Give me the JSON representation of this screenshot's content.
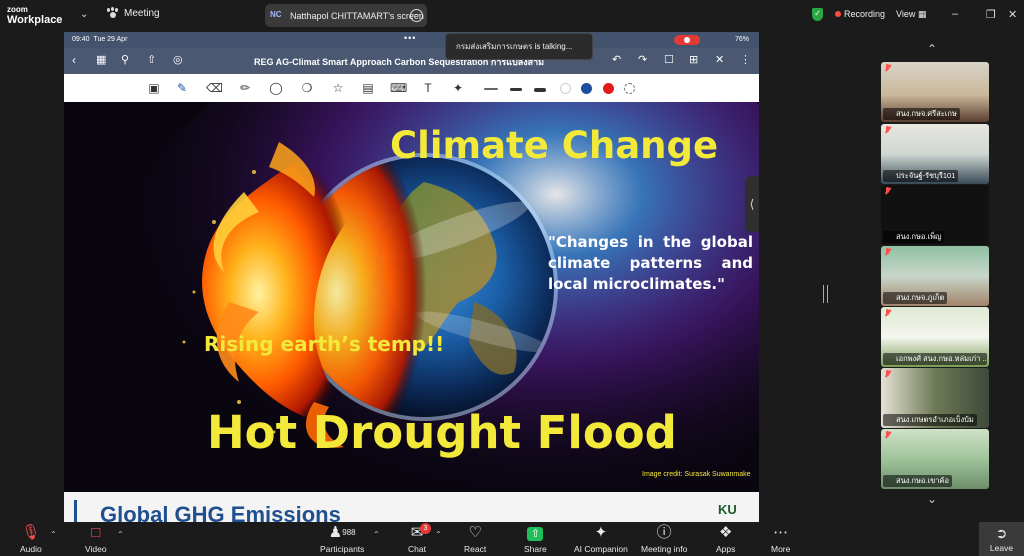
{
  "app": {
    "logo_line1": "zoom",
    "logo_line2": "Workplace",
    "meeting_label": "Meeting"
  },
  "share_pill": {
    "initials": "NC",
    "label": "Natthapol CHITTAMART's screen"
  },
  "status": {
    "recording_label": "Recording",
    "view_label": "View"
  },
  "colors": {
    "accent_yellow": "#f2e93a",
    "recording_red": "#ff4a3d",
    "shield_green": "#29a745",
    "ipad_bar": "#44536d"
  },
  "toast": {
    "text": "กรมส่งเสริมการเกษตร is talking..."
  },
  "ipad": {
    "time": "09:40",
    "date": "Tue 29 Apr",
    "battery": "76%",
    "document_title": "REG AG-Climat Smart Approach Carbon Sequestration การแปลงสามั"
  },
  "slide": {
    "title": "Climate Change",
    "quote": "\"Changes in the global climate patterns and local microclimates.\"",
    "rising": "Rising earth’s temp!!",
    "headline": "Hot Drought Flood",
    "credit": "Image credit: Surasak Suwanmake"
  },
  "next_slide": {
    "heading": "Global GHG Emissions",
    "logo": "KU"
  },
  "gallery": {
    "tiles": [
      {
        "name": "สนง.กษจ.ศรีสะเกษ"
      },
      {
        "name": "ประจันฐ์-รัชบุรี101"
      },
      {
        "name": "สนง.กษอ.เพ็ญ"
      },
      {
        "name": "สนง.กษจ.ภูเก็ต"
      },
      {
        "name": "เอกพงศ์ สนง.กษอ.หล่มเก่า ..."
      },
      {
        "name": "สนง.เกษตรอำเภอเบ็งบ้ม"
      },
      {
        "name": "สนง.กษอ.เขาค้อ"
      }
    ]
  },
  "toolbar": {
    "audio": "Audio",
    "video": "Video",
    "participants": "Participants",
    "participants_count": "988",
    "chat": "Chat",
    "chat_badge": "3",
    "react": "React",
    "share": "Share",
    "ai": "AI Companion",
    "info": "Meeting info",
    "apps": "Apps",
    "more": "More",
    "leave": "Leave"
  }
}
